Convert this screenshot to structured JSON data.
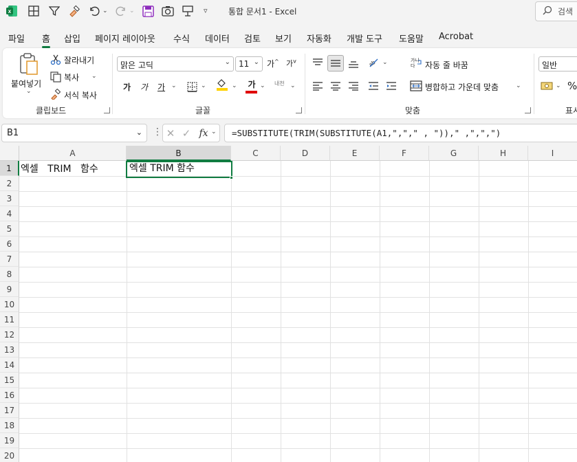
{
  "titlebar": {
    "title": "통합 문서1 - Excel",
    "search_placeholder": "검색",
    "icons": [
      "excel-logo",
      "table-icon",
      "filter-icon",
      "format-painter-icon",
      "undo-icon",
      "redo-icon",
      "save-icon",
      "camera-icon",
      "screen-icon",
      "customize-icon"
    ]
  },
  "menu": {
    "tabs": [
      "파일",
      "홈",
      "삽입",
      "페이지 레이아웃",
      "수식",
      "데이터",
      "검토",
      "보기",
      "자동화",
      "개발 도구",
      "도움말",
      "Acrobat"
    ],
    "active": "홈"
  },
  "ribbon": {
    "clipboard": {
      "paste": "붙여넣기",
      "cut": "잘라내기",
      "copy": "복사",
      "format_painter": "서식 복사",
      "label": "클립보드"
    },
    "font": {
      "font_name": "맑은 고딕",
      "font_size": "11",
      "grow": "가",
      "shrink": "가",
      "bold": "가",
      "italic": "가",
      "underline": "가",
      "font_color": "가",
      "phonetic": "내천",
      "label": "글꼴",
      "fill_color": "#ffd200",
      "text_color": "#e00000"
    },
    "alignment": {
      "wrap_text": "자동 줄 바꿈",
      "merge_center": "병합하고 가운데 맞춤",
      "label": "맞춤"
    },
    "number": {
      "format": "일반",
      "percent": "%",
      "label": "표시"
    }
  },
  "formula_bar": {
    "name_box": "B1",
    "fx": "fx",
    "formula": "=SUBSTITUTE(TRIM(SUBSTITUTE(A1,\",\",\" , \")),\" ,\",\",\")"
  },
  "sheet": {
    "columns": [
      "A",
      "B",
      "C",
      "D",
      "E",
      "F",
      "G",
      "H",
      "I"
    ],
    "rows": [
      "1",
      "2",
      "3",
      "4",
      "5",
      "6",
      "7",
      "8",
      "9",
      "10",
      "11",
      "12",
      "13",
      "14",
      "15",
      "16",
      "17",
      "18",
      "19",
      "20"
    ],
    "selected_cell": "B1",
    "cells": {
      "A1": "엑셀   TRIM   함수",
      "B1": "엑셀 TRIM 함수"
    },
    "accent": "#107c41"
  }
}
